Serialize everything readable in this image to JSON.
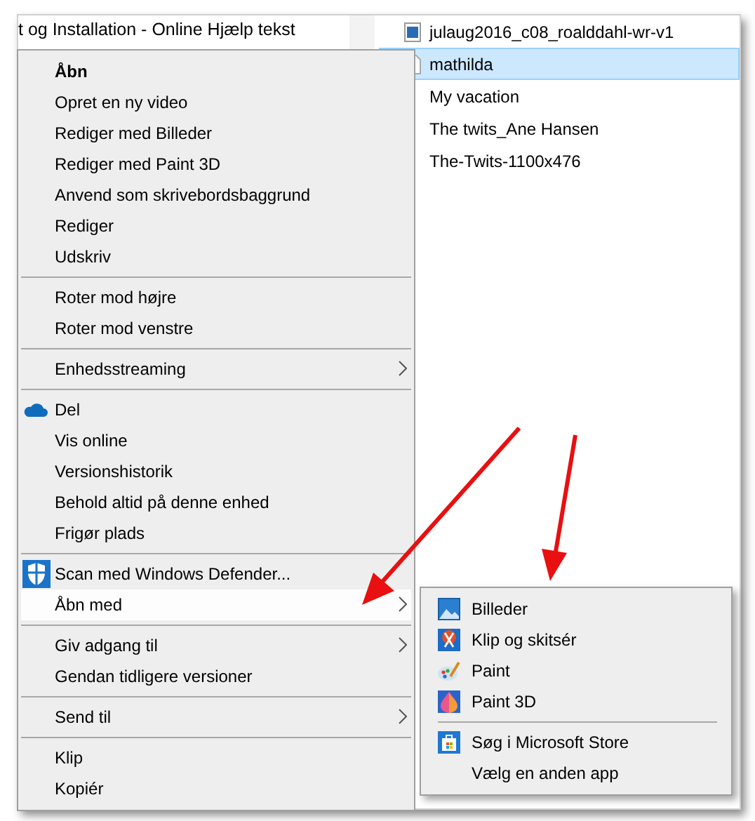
{
  "window": {
    "header_text": "t og Installation - Online Hjælp tekst"
  },
  "files": [
    {
      "name": "julaug2016_c08_roalddahl-wr-v1",
      "selected": false
    },
    {
      "name": "mathilda",
      "selected": true
    },
    {
      "name": "My vacation",
      "selected": false
    },
    {
      "name": "The twits_Ane Hansen",
      "selected": false
    },
    {
      "name": "The-Twits-1100x476",
      "selected": false
    }
  ],
  "context_menu": {
    "items": [
      {
        "kind": "item",
        "label": "Åbn",
        "bold": true,
        "selected": false
      },
      {
        "kind": "item",
        "label": "Opret en ny video",
        "selected": false
      },
      {
        "kind": "item",
        "label": "Rediger med Billeder",
        "selected": false
      },
      {
        "kind": "item",
        "label": "Rediger med Paint 3D",
        "selected": false
      },
      {
        "kind": "item",
        "label": "Anvend som skrivebordsbaggrund",
        "selected": false
      },
      {
        "kind": "item",
        "label": "Rediger",
        "selected": false
      },
      {
        "kind": "item",
        "label": "Udskriv",
        "selected": false
      },
      {
        "kind": "separator"
      },
      {
        "kind": "item",
        "label": "Roter mod højre",
        "selected": false
      },
      {
        "kind": "item",
        "label": "Roter mod venstre",
        "selected": false
      },
      {
        "kind": "separator"
      },
      {
        "kind": "item",
        "label": "Enhedsstreaming",
        "has_submenu": true,
        "selected": false
      },
      {
        "kind": "separator"
      },
      {
        "kind": "item",
        "label": "Del",
        "selected": false
      },
      {
        "kind": "item",
        "label": "Vis online",
        "selected": false
      },
      {
        "kind": "item",
        "label": "Versionshistorik",
        "selected": false
      },
      {
        "kind": "item",
        "label": "Behold altid på denne enhed",
        "selected": false
      },
      {
        "kind": "item",
        "label": "Frigør plads",
        "selected": false
      },
      {
        "kind": "separator"
      },
      {
        "kind": "item",
        "label": "Scan med Windows Defender...",
        "selected": false
      },
      {
        "kind": "item",
        "label": "Åbn med",
        "has_submenu": true,
        "selected": true
      },
      {
        "kind": "separator"
      },
      {
        "kind": "item",
        "label": "Giv adgang til",
        "has_submenu": true,
        "selected": false
      },
      {
        "kind": "item",
        "label": "Gendan tidligere versioner",
        "selected": false
      },
      {
        "kind": "separator"
      },
      {
        "kind": "item",
        "label": "Send til",
        "has_submenu": true,
        "selected": false
      },
      {
        "kind": "separator"
      },
      {
        "kind": "item",
        "label": "Klip",
        "selected": false
      },
      {
        "kind": "item",
        "label": "Kopiér",
        "selected": false
      }
    ]
  },
  "submenu": {
    "items": [
      {
        "kind": "item",
        "label": "Billeder",
        "selected": false
      },
      {
        "kind": "item",
        "label": "Klip og skitsér",
        "selected": false
      },
      {
        "kind": "item",
        "label": "Paint",
        "selected": false
      },
      {
        "kind": "item",
        "label": "Paint 3D",
        "selected": false
      },
      {
        "kind": "separator"
      },
      {
        "kind": "item",
        "label": "Søg i Microsoft Store",
        "selected": false
      },
      {
        "kind": "item",
        "label": "Vælg en anden app",
        "selected": false
      }
    ]
  }
}
